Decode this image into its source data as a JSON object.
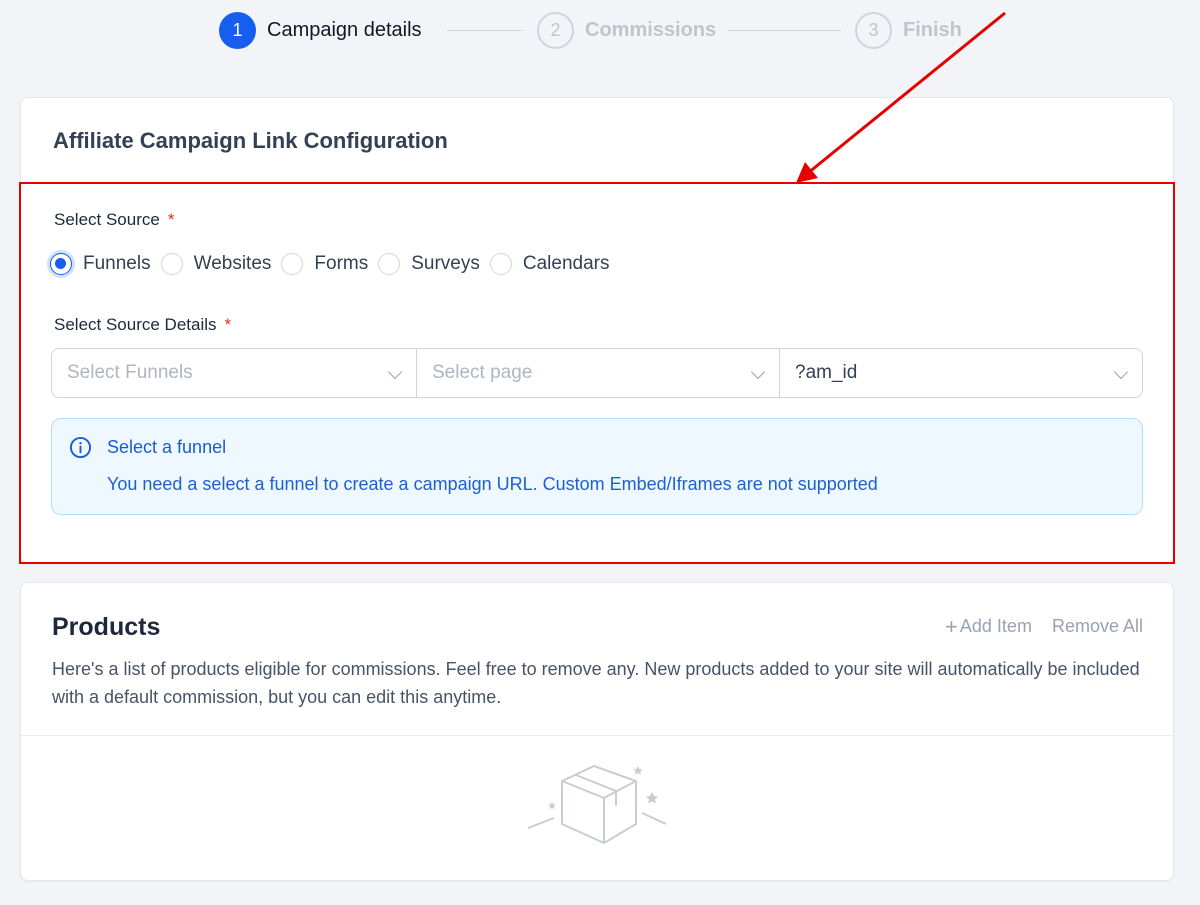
{
  "stepper": {
    "steps": [
      {
        "num": "1",
        "label": "Campaign details",
        "state": "active"
      },
      {
        "num": "2",
        "label": "Commissions",
        "state": "inactive"
      },
      {
        "num": "3",
        "label": "Finish",
        "state": "inactive"
      }
    ]
  },
  "config": {
    "title": "Affiliate Campaign Link Configuration",
    "source_label": "Select Source",
    "required_mark": "*",
    "source_options": [
      "Funnels",
      "Websites",
      "Forms",
      "Surveys",
      "Calendars"
    ],
    "selected_source": "Funnels",
    "details_label": "Select Source Details",
    "selects": {
      "funnel_placeholder": "Select Funnels",
      "page_placeholder": "Select page",
      "param_value": "?am_id"
    },
    "info": {
      "title": "Select a funnel",
      "text": "You need a select a funnel to create a campaign URL. Custom Embed/Iframes are not supported"
    }
  },
  "products": {
    "title": "Products",
    "add_item_label": "Add Item",
    "remove_all_label": "Remove All",
    "description": "Here's a list of products eligible for commissions. Feel free to remove any. New products added to your site will automatically be included with a default commission, but you can edit this anytime."
  },
  "colors": {
    "primary": "#155eef",
    "annotation_red": "#e60000",
    "info_bg": "#eff8ff",
    "info_text": "#175cd3"
  },
  "icons": {
    "info": "info-circle-icon",
    "chevron": "chevron-down-icon",
    "plus": "plus-icon",
    "empty": "empty-box-icon"
  }
}
